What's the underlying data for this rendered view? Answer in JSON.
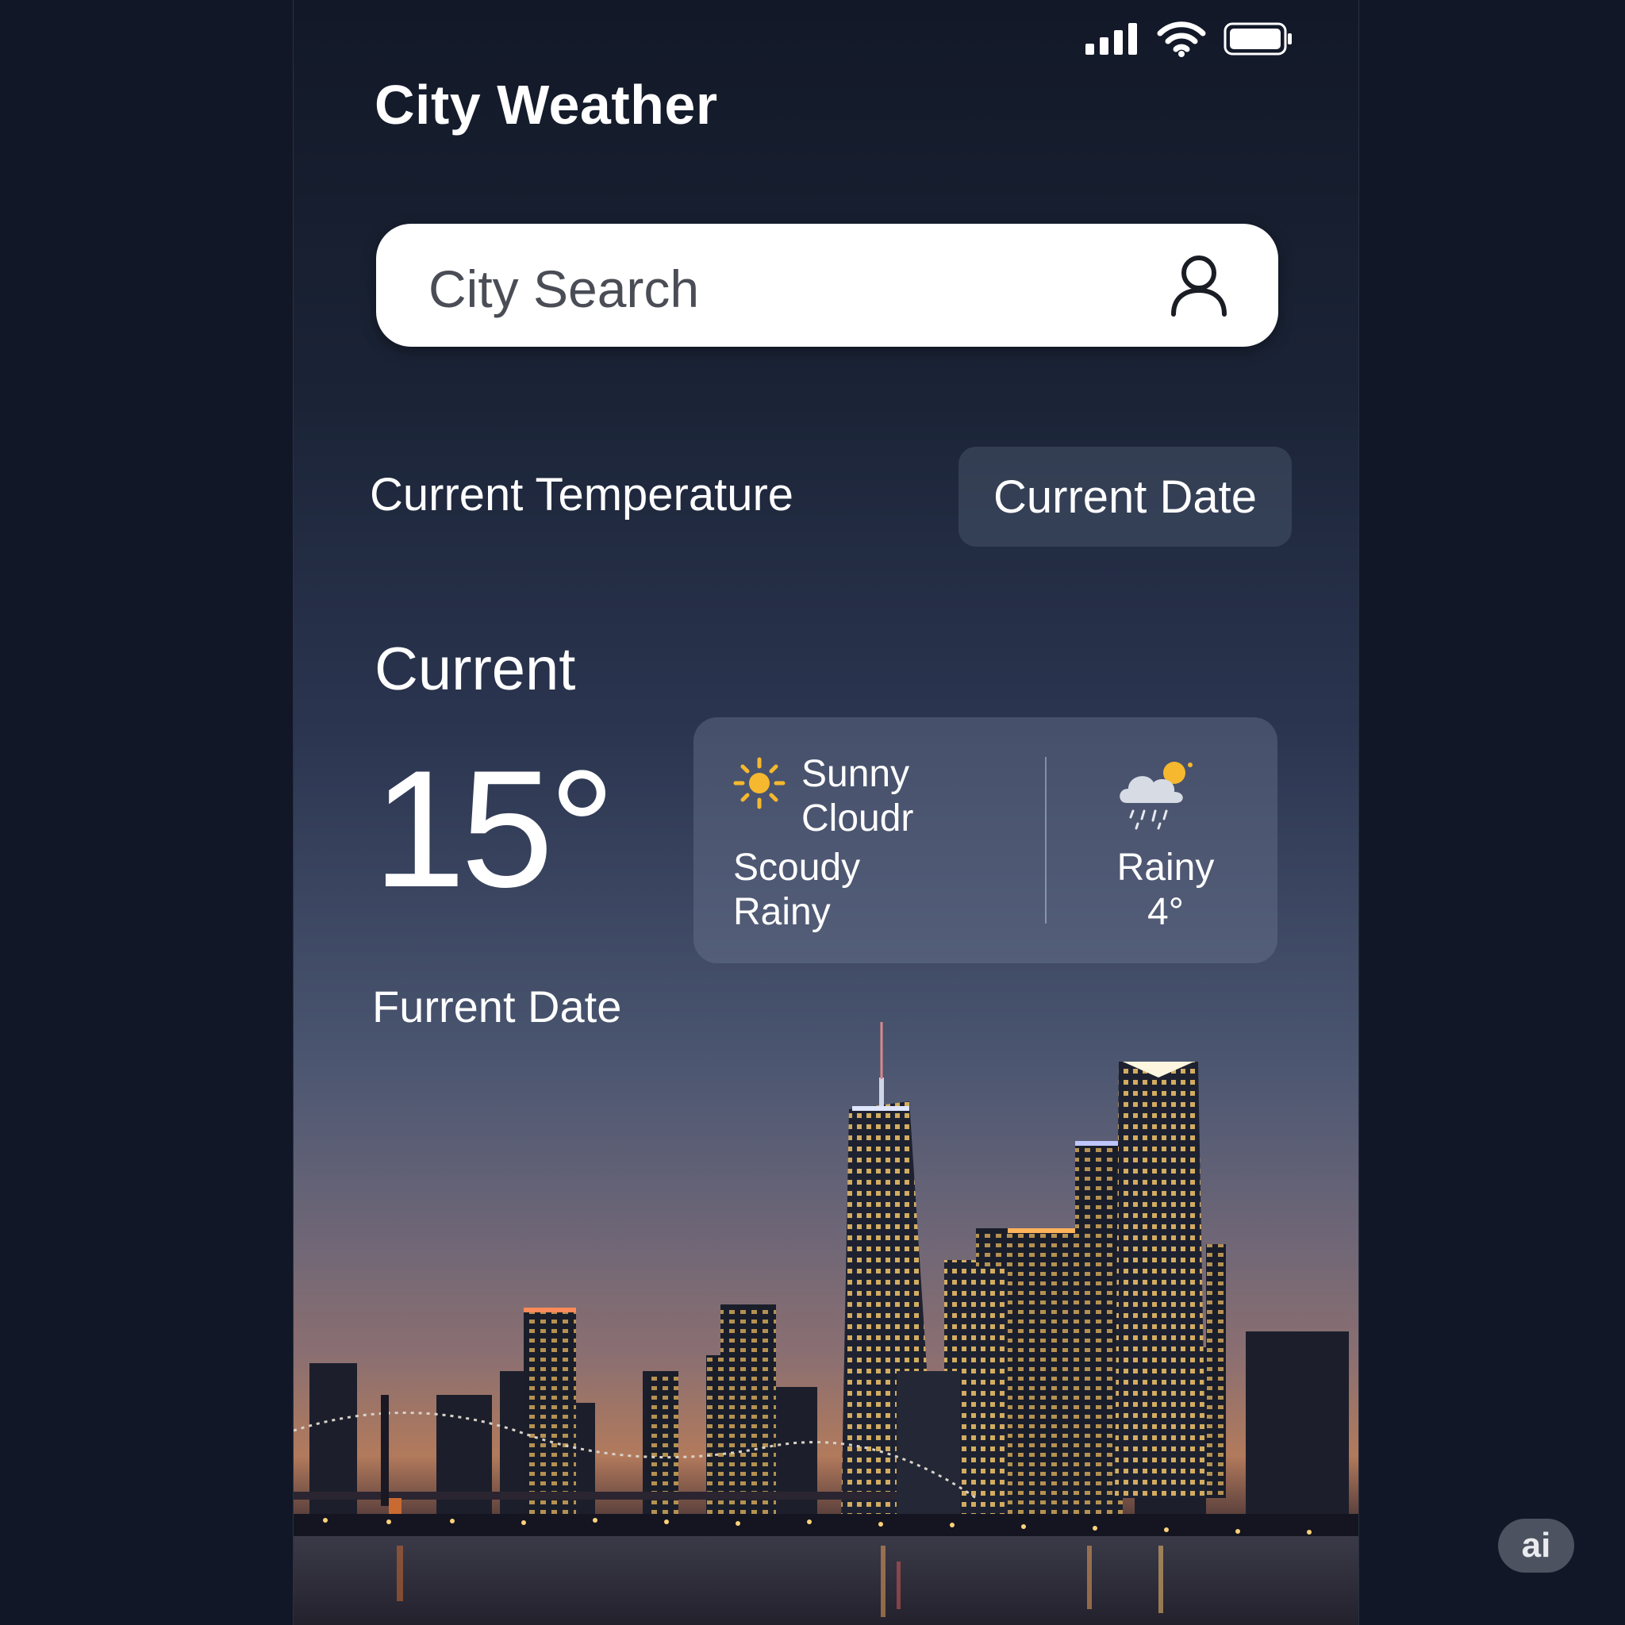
{
  "app": {
    "title": "City Weather"
  },
  "status_bar": {
    "icons": [
      "signal-icon",
      "wifi-icon",
      "battery-icon"
    ]
  },
  "search": {
    "placeholder": "City Search",
    "icon": "user-icon"
  },
  "labels": {
    "current_temperature": "Current Temperature",
    "current_date_button": "Current Date"
  },
  "current": {
    "heading": "Current",
    "temperature": "15°",
    "date_label": "Furrent Date"
  },
  "forecast_card": {
    "left": {
      "icon": "sun-icon",
      "line1": "Sunny",
      "line2": "Cloudr",
      "line3": "Scoudy",
      "line4": "Rainy"
    },
    "right": {
      "icon": "rain-cloud-sun-icon",
      "line1": "Rainy",
      "line2": "4°"
    }
  },
  "badge": {
    "label": "ai"
  },
  "colors": {
    "background": "#111726",
    "card": "#5a6580",
    "accent_sun": "#f5b82e"
  }
}
